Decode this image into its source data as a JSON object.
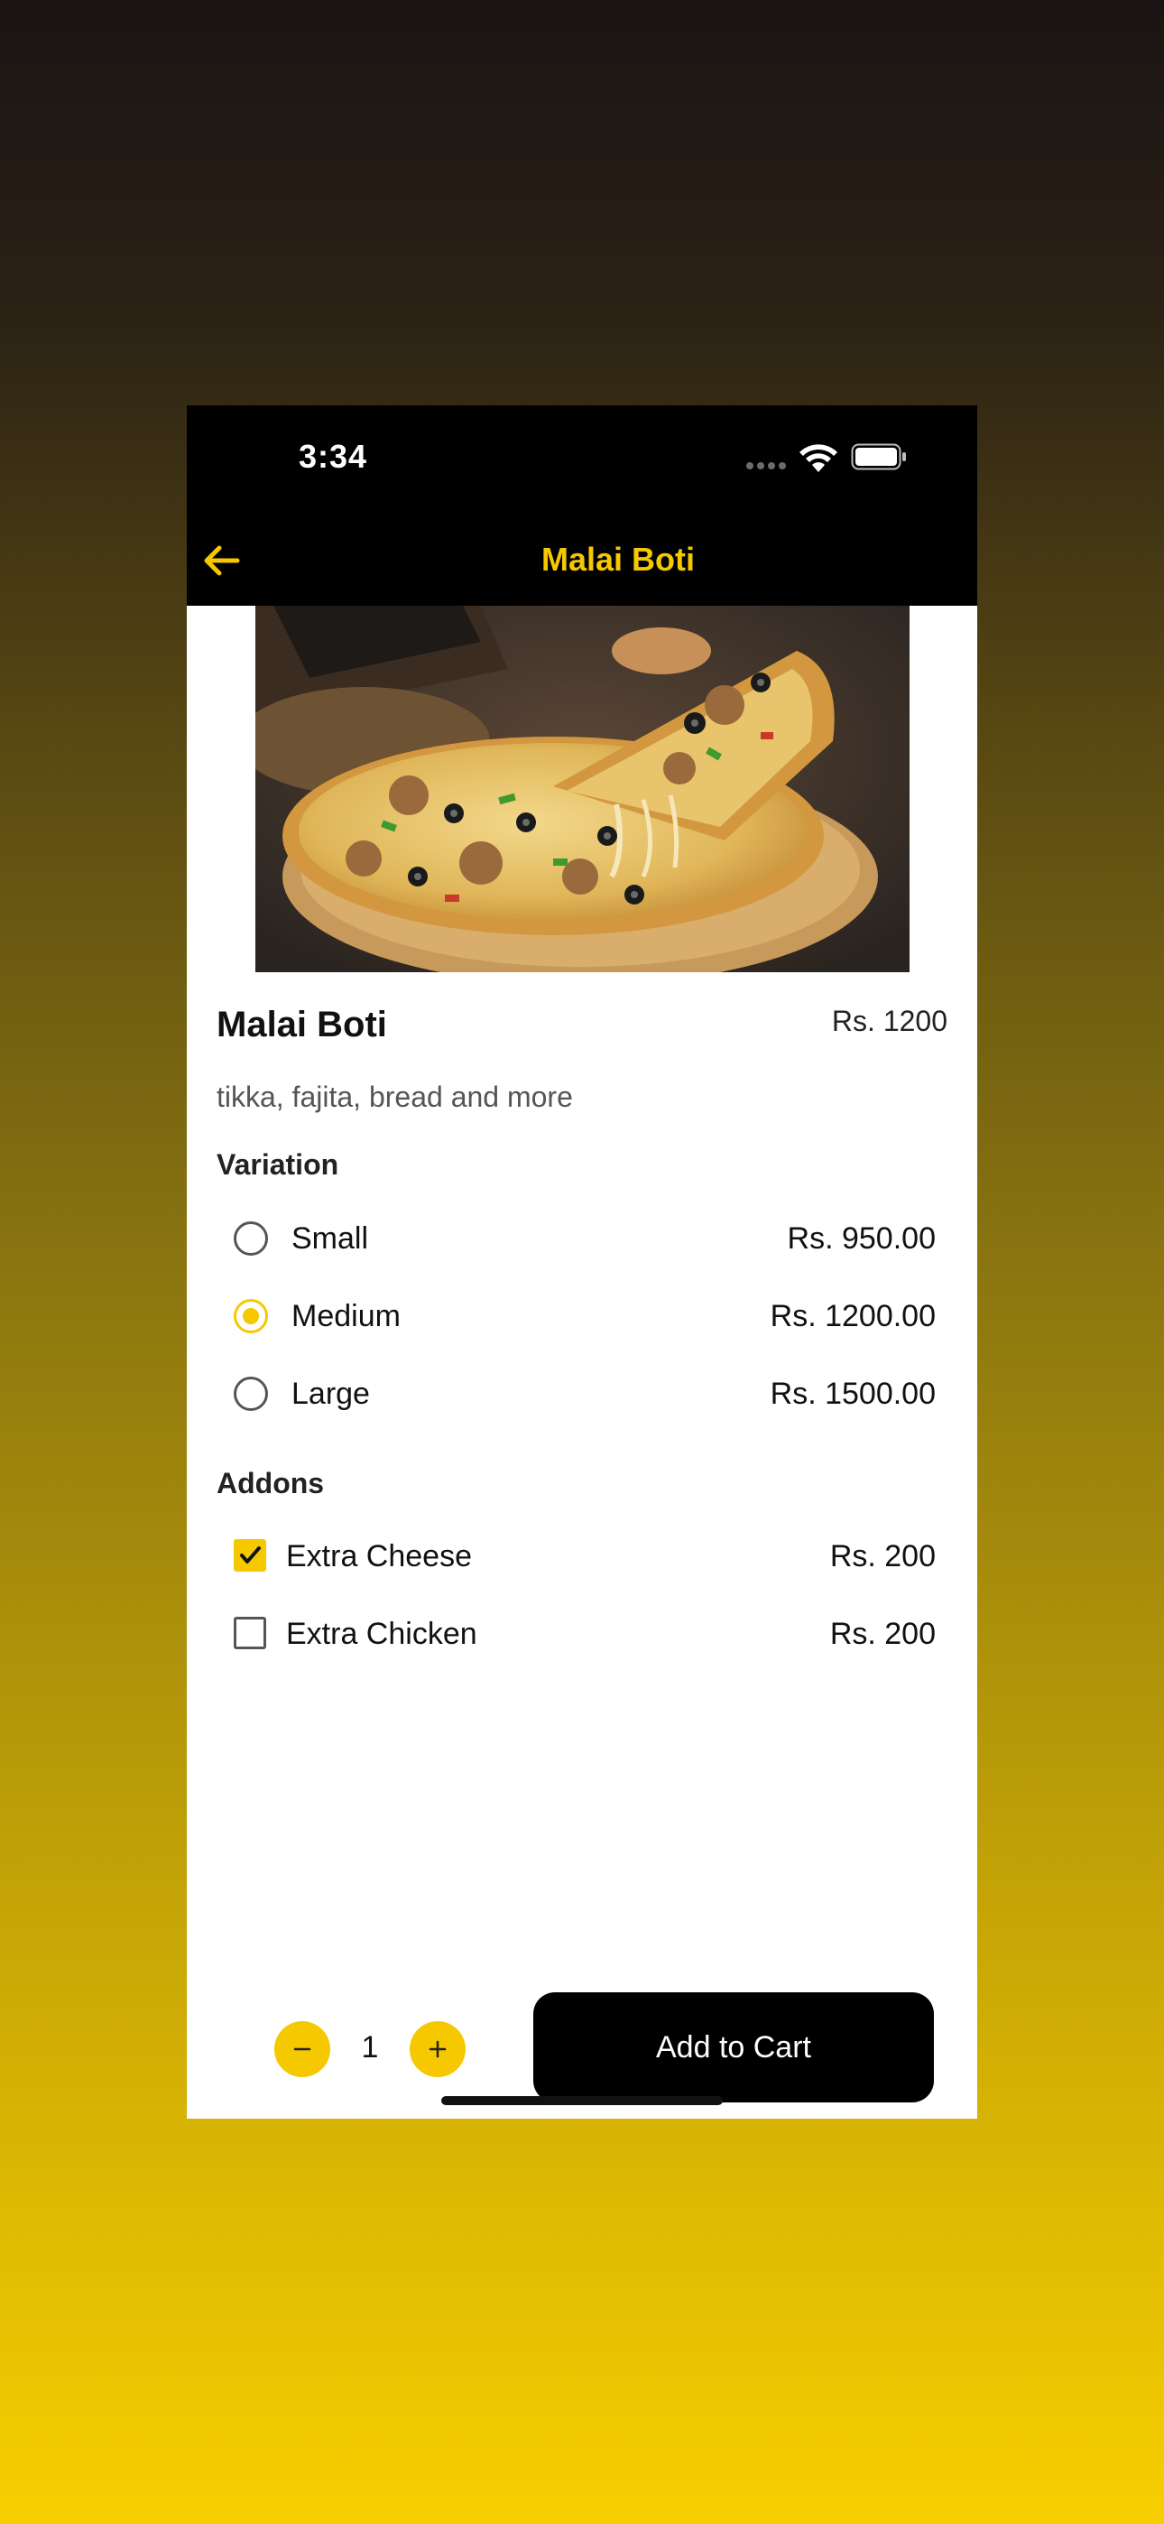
{
  "status_bar": {
    "time": "3:34"
  },
  "header": {
    "title": "Malai Boti",
    "back_icon": "arrow-left-icon"
  },
  "product": {
    "name": "Malai Boti",
    "price": "Rs. 1200",
    "description": "tikka, fajita, bread and more",
    "image": "pizza-photo"
  },
  "variation": {
    "title": "Variation",
    "options": [
      {
        "label": "Small",
        "price": "Rs. 950.00",
        "selected": false
      },
      {
        "label": "Medium",
        "price": "Rs. 1200.00",
        "selected": true
      },
      {
        "label": "Large",
        "price": "Rs. 1500.00",
        "selected": false
      }
    ]
  },
  "addons": {
    "title": "Addons",
    "options": [
      {
        "label": "Extra Cheese",
        "price": "Rs. 200",
        "checked": true
      },
      {
        "label": "Extra Chicken",
        "price": "Rs. 200",
        "checked": false
      }
    ]
  },
  "cart": {
    "quantity": "1",
    "add_label": "Add to Cart",
    "decrement_icon": "minus-icon",
    "increment_icon": "plus-icon"
  },
  "colors": {
    "accent": "#f5c800",
    "header_bg": "#000000",
    "page_bg": "#ffffff"
  }
}
